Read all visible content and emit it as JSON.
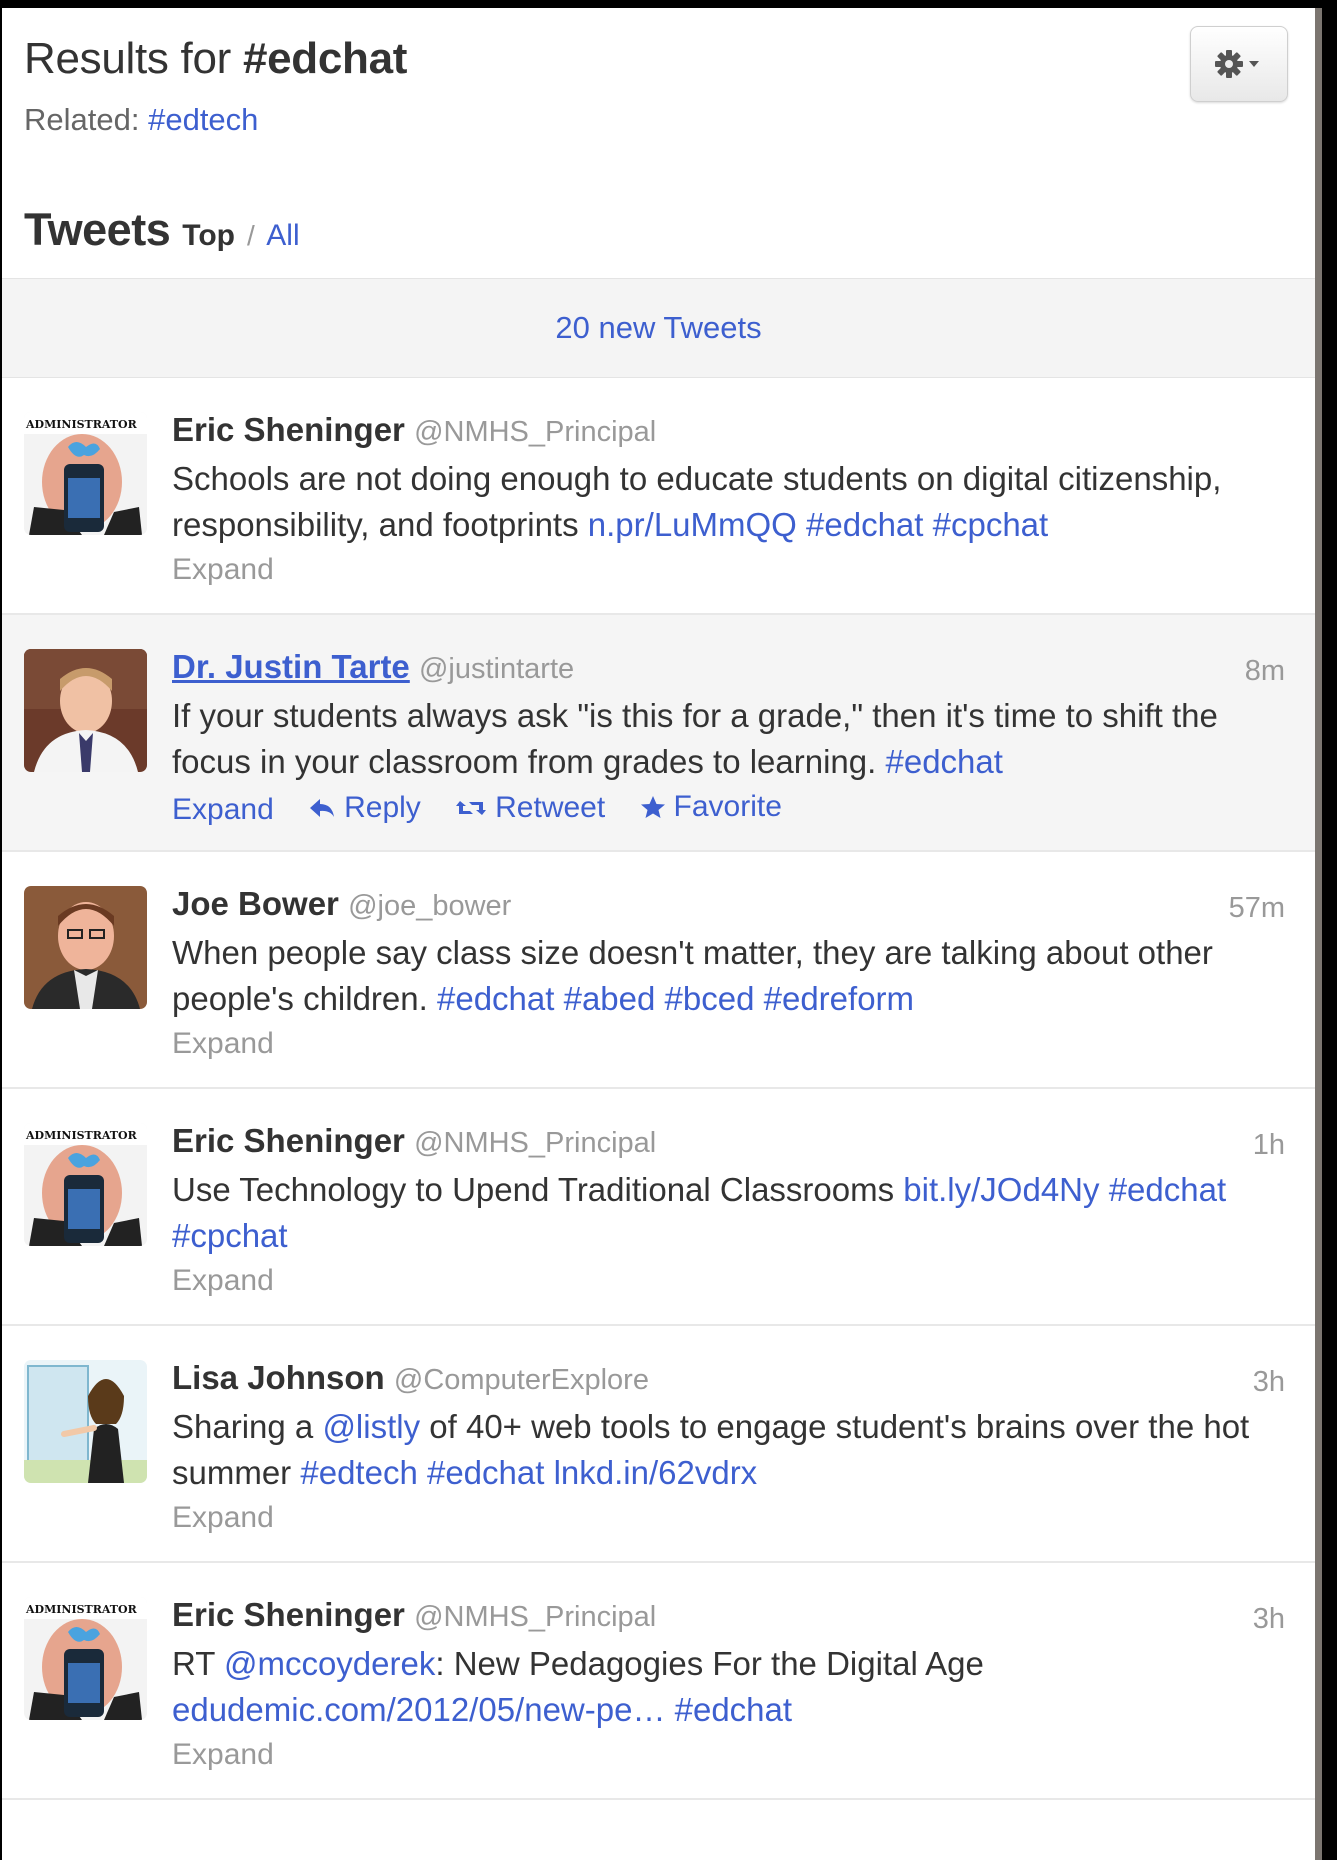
{
  "header": {
    "results_prefix": "Results for",
    "query": "#edchat",
    "related_label": "Related:",
    "related_tag": "#edtech",
    "tweets_label": "Tweets",
    "filter_top": "Top",
    "filter_sep": "/",
    "filter_all": "All"
  },
  "new_tweets_bar": "20 new Tweets",
  "tweets": [
    {
      "name": "Eric Sheninger",
      "handle": "@NMHS_Principal",
      "time": "",
      "text_parts": [
        "Schools are not doing enough to educate students on digital citizenship, responsibility, and footprints "
      ],
      "link1": "n.pr/LuMmQQ",
      "tag1": "#edchat",
      "tag2": "#cpchat",
      "expand": "Expand"
    },
    {
      "name": "Dr. Justin Tarte",
      "handle": "@justintarte",
      "time": "8m",
      "text": "If your students always ask \"is this for a grade,\" then it's time to shift the focus in your classroom from grades to learning.",
      "tag1": "#edchat",
      "expand": "Expand",
      "reply": "Reply",
      "retweet": "Retweet",
      "favorite": "Favorite"
    },
    {
      "name": "Joe Bower",
      "handle": "@joe_bower",
      "time": "57m",
      "text": "When people say class size doesn't matter, they are talking about other people's children.",
      "tag1": "#edchat",
      "tag2": "#abed",
      "tag3": "#bced",
      "tag4": "#edreform",
      "expand": "Expand"
    },
    {
      "name": "Eric Sheninger",
      "handle": "@NMHS_Principal",
      "time": "1h",
      "text": "Use Technology to Upend Traditional Classrooms",
      "link1": "bit.ly/JOd4Ny",
      "tag1": "#edchat",
      "tag2": "#cpchat",
      "expand": "Expand"
    },
    {
      "name": "Lisa Johnson",
      "handle": "@ComputerExplore",
      "time": "3h",
      "text_a": "Sharing a",
      "mention": "@listly",
      "text_b": "of 40+ web tools to engage student's brains over the hot summer",
      "tag1": "#edtech",
      "tag2": "#edchat",
      "link1": "lnkd.in/62vdrx",
      "expand": "Expand"
    },
    {
      "name": "Eric Sheninger",
      "handle": "@NMHS_Principal",
      "time": "3h",
      "text_a": "RT",
      "mention": "@mccoyderek",
      "text_b": ": New Pedagogies For the Digital Age",
      "link1": "edudemic.com/2012/05/new-pe…",
      "tag1": "#edchat",
      "expand": "Expand"
    }
  ],
  "avatar_logo_text": "ADMINISTRATOR",
  "colors": {
    "link": "#3d5fcf",
    "text": "#333333",
    "muted": "#999999"
  }
}
